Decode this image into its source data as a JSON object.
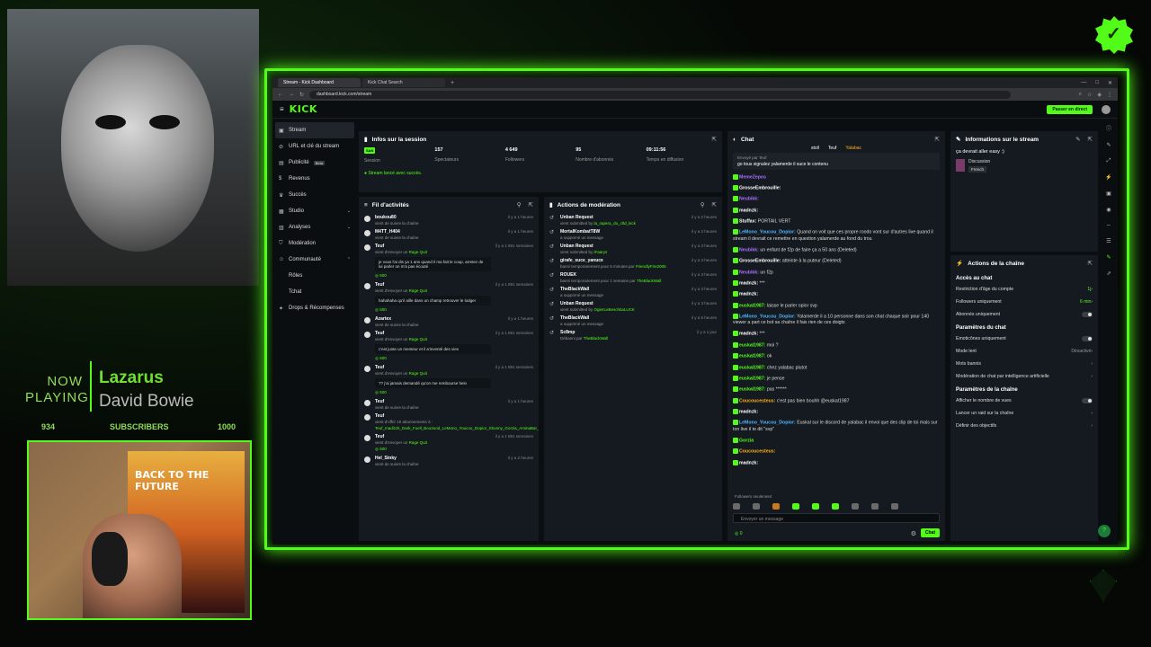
{
  "overlay": {
    "now_label": "NOW",
    "playing_label": "PLAYING",
    "song_title": "Lazarus",
    "song_artist": "David Bowie",
    "sub_count": "934",
    "sub_label": "SUBSCRIBERS",
    "sub_goal": "1000",
    "poster_text": "BACK TO THE FUTURE"
  },
  "browser": {
    "tabs": [
      "Stream - Kick Dashboard",
      "Kick Chat Search"
    ],
    "url": "dashboard.kick.com/stream"
  },
  "kick": {
    "logo": "KICK",
    "go_live": "Passer en direct"
  },
  "sidebar": {
    "items": [
      {
        "label": "Stream"
      },
      {
        "label": "URL et clé du stream"
      },
      {
        "label": "Publicité",
        "badge": "Beta"
      },
      {
        "label": "Revenus"
      },
      {
        "label": "Succès"
      },
      {
        "label": "Studio"
      },
      {
        "label": "Analyses"
      },
      {
        "label": "Modération"
      },
      {
        "label": "Communauté"
      },
      {
        "label": "Rôles"
      },
      {
        "label": "Tchat"
      },
      {
        "label": "Drops & Récompenses"
      }
    ]
  },
  "session": {
    "title": "Infos sur la session",
    "stats": [
      {
        "value": "SAN",
        "label": "Session"
      },
      {
        "value": "157",
        "label": "Spectateurs"
      },
      {
        "value": "4 649",
        "label": "Followers"
      },
      {
        "value": "95",
        "label": "Nombre d'abonnés"
      },
      {
        "value": "09:11:56",
        "label": "Temps en diffusion"
      }
    ],
    "success": "Stream lancé avec succès."
  },
  "activity": {
    "title": "Fil d'activités",
    "items": [
      {
        "name": "boukou80",
        "sub": "vient de suivre la chaîne",
        "time": "il y a 1 heures",
        "msg": "",
        "kicks": ""
      },
      {
        "name": "M4TT_H404",
        "sub": "vient de suivre la chaîne",
        "time": "il y a 1 heures",
        "msg": "",
        "kicks": ""
      },
      {
        "name": "Teuf",
        "sub": "vient d'envoyer un",
        "link": "Rage Quit",
        "time": "il y a 1 891 semaines",
        "msg": "je vous l'ai dis ya 1 ans quand il ma fait le coup, arretez de lui parler on m'a pas écouté",
        "kicks": "500"
      },
      {
        "name": "Teuf",
        "sub": "vient d'envoyer un",
        "link": "Rage Quit",
        "time": "il y a 1 891 semaines",
        "msg": "hahahaha qu'il aille dans un champ retrouver le lodger",
        "kicks": "500"
      },
      {
        "name": "Azartex",
        "sub": "vient de suivre la chaîne",
        "time": "il y a 1 heures",
        "msg": "",
        "kicks": ""
      },
      {
        "name": "Teuf",
        "sub": "vient d'envoyer un",
        "link": "Rage Quit",
        "time": "il y a 1 891 semaines",
        "msg": "c'est juste un menteur et il a'inventé des vies",
        "kicks": "500"
      },
      {
        "name": "Teuf",
        "sub": "vient d'envoyer un",
        "link": "Rage Quit",
        "time": "il y a 1 891 semaines",
        "msg": "?? j'ai jamais demandé qu'on me rembourse hein",
        "kicks": "500"
      },
      {
        "name": "Teuf",
        "sub": "vient de suivre la chaîne",
        "time": "il y a 1 heures",
        "msg": "",
        "kicks": ""
      },
      {
        "name": "Teuf",
        "sub": "vient d'offrir 10 abonnements à :",
        "time": "il y a 1 891 semaines",
        "msg": "",
        "kicks": "",
        "gift": "Teuf_madizzk_Dark_Fuell_Boo3ood_LeMono_Youcou_Dopior_Shunny_Gorzia_AminaBar_Shinogara75_Kapsiamachine"
      },
      {
        "name": "Teuf",
        "sub": "vient d'envoyer un",
        "link": "Rage Quit",
        "time": "il y a 1 891 semaines",
        "msg": "",
        "kicks": "500"
      },
      {
        "name": "Hel_Sinky",
        "sub": "vient de suivre la chaîne",
        "time": "il y a 2 heures",
        "msg": "",
        "kicks": ""
      }
    ]
  },
  "moderation": {
    "title": "Actions de modération",
    "items": [
      {
        "name": "Unban Request",
        "sub": "vient submitted by",
        "link": "la_rapera_du_cltd_kick",
        "time": "il y a 2 heures"
      },
      {
        "name": "MortalKombatT8W",
        "sub": "a supprimé un message",
        "link": "",
        "time": "il y a 2 heures"
      },
      {
        "name": "Unban Request",
        "sub": "vient submitted by",
        "link": "iFaarys",
        "time": "il y a 3 heures"
      },
      {
        "name": "girafe_suce_yanuce",
        "sub": "banni temporairement pour 5 minutes par",
        "link": "FriendlyFire2005",
        "time": "il y a 3 heures"
      },
      {
        "name": "ROUEK",
        "sub": "banni temporairement pour 1 semaine par",
        "link": "TheBlackWall",
        "time": "il y a 3 heures"
      },
      {
        "name": "TheBlackWall",
        "sub": "a supprimé un message",
        "link": "",
        "time": "il y a 3 heures"
      },
      {
        "name": "Unban Request",
        "sub": "vient submitted by",
        "link": "OgierLeBeschtiaLUCK",
        "time": "il y a 3 heures"
      },
      {
        "name": "TheBlackWall",
        "sub": "a supprimé un message",
        "link": "",
        "time": "il y a 5 heures"
      },
      {
        "name": "Sc8mp",
        "sub": "Débanni par",
        "link": "TheBlackWall",
        "time": "il y a 1 jour"
      }
    ]
  },
  "chat": {
    "title": "Chat",
    "top_users": [
      "stoll",
      "Teuf",
      "Yalabac"
    ],
    "pinned_by": "Envoyé par Teuf",
    "pinned_text": "go tous signalez yalamerde il suce le contenu",
    "messages": [
      {
        "user": "MemeZepos",
        "color": "#a970ff",
        "text": ""
      },
      {
        "user": "GrosseEmbrouille:",
        "color": "#ffffff",
        "text": ""
      },
      {
        "user": "Neubikk:",
        "color": "#a970ff",
        "text": ""
      },
      {
        "user": "madnzk:",
        "color": "#ffffff",
        "text": ""
      },
      {
        "user": "Stuffax:",
        "color": "#ffffff",
        "text": "PORTAIL VERT"
      },
      {
        "user": "LeMono_Youcou_Dopior:",
        "color": "#53b4ff",
        "text": "Quand on voit que ces propre roodo vont sur d'autres live quand il stream il devrait ce remettre en question yalamerde au fond du trou"
      },
      {
        "user": "Neubikk:",
        "color": "#a970ff",
        "text": "un enfant de f2p de faire ça a 50 ans (Deleted)"
      },
      {
        "user": "GrosseEmbrouille:",
        "color": "#ffffff",
        "text": "atteinte à la puteur (Deleted)"
      },
      {
        "user": "Neubikk:",
        "color": "#a970ff",
        "text": "un f2p"
      },
      {
        "user": "madnzk:",
        "color": "#ffffff",
        "text": "***"
      },
      {
        "user": "madnzk:",
        "color": "#ffffff",
        "text": ""
      },
      {
        "user": "euskal1987:",
        "color": "#53fc18",
        "text": "laisse le parler opior svp"
      },
      {
        "user": "LeMono_Youcou_Dopior:",
        "color": "#53b4ff",
        "text": "Yalamerde il a 10 personne dans son chat chaque soir pour 140 viewer a part ce bot sa chaîne il fais rien de ces doigts"
      },
      {
        "user": "madnzk:",
        "color": "#ffffff",
        "text": "***"
      },
      {
        "user": "euskal1987:",
        "color": "#53fc18",
        "text": "moi ?"
      },
      {
        "user": "euskal1987:",
        "color": "#53fc18",
        "text": "ok"
      },
      {
        "user": "euskal1987:",
        "color": "#53fc18",
        "text": "chez yalabac plutot"
      },
      {
        "user": "euskal1987:",
        "color": "#53fc18",
        "text": "je pense"
      },
      {
        "user": "euskal1987:",
        "color": "#53fc18",
        "text": "pas ******"
      },
      {
        "user": "Coucoucesteus:",
        "color": "#ffb020",
        "text": "c'est pas bien bouhh @euskal1987"
      },
      {
        "user": "madnzk:",
        "color": "#ffffff",
        "text": ""
      },
      {
        "user": "LeMono_Youcou_Dopior:",
        "color": "#53b4ff",
        "text": "Euskal sur le discord de yalabac il envoi que des clip de toi mais sur ton live il te dit \"svp\""
      },
      {
        "user": "Gorzia",
        "color": "#53fc18",
        "text": ""
      },
      {
        "user": "Coucoucesteus:",
        "color": "#ffb020",
        "text": ""
      },
      {
        "user": "madnzk:",
        "color": "#ffffff",
        "text": ""
      }
    ],
    "followers_only": "Followers seulement",
    "input_placeholder": "Envoyer un message",
    "send_label": "Chat",
    "kicks_count": "0"
  },
  "stream_info": {
    "title": "Informations sur le stream",
    "stream_title": "ça devrait aller easy :)",
    "category": "Discussion",
    "language": "French"
  },
  "channel_actions": {
    "title": "Actions de la chaîne",
    "sections": [
      {
        "heading": "Accès au chat",
        "rows": [
          {
            "label": "Restriction d'âge du compte",
            "value": "1j",
            "type": "link"
          },
          {
            "label": "Followers uniquement",
            "value": "6 min",
            "type": "link"
          },
          {
            "label": "Abonnés uniquement",
            "value": "",
            "type": "toggle"
          }
        ]
      },
      {
        "heading": "Paramètres du chat",
        "rows": [
          {
            "label": "Emoticônes uniquement",
            "value": "",
            "type": "toggle"
          },
          {
            "label": "Mode lent",
            "value": "Désactivé",
            "type": "grey"
          },
          {
            "label": "Mots bannis",
            "value": "",
            "type": "chev"
          },
          {
            "label": "Modération de chat par intelligence artificielle",
            "value": "",
            "type": "chev"
          }
        ]
      },
      {
        "heading": "Paramètres de la chaîne",
        "rows": [
          {
            "label": "Afficher le nombre de vues",
            "value": "",
            "type": "toggle"
          },
          {
            "label": "Lancer un raid sur la chaîne",
            "value": "",
            "type": "chev"
          },
          {
            "label": "Définir des objectifs",
            "value": "",
            "type": "chev"
          }
        ]
      }
    ]
  }
}
